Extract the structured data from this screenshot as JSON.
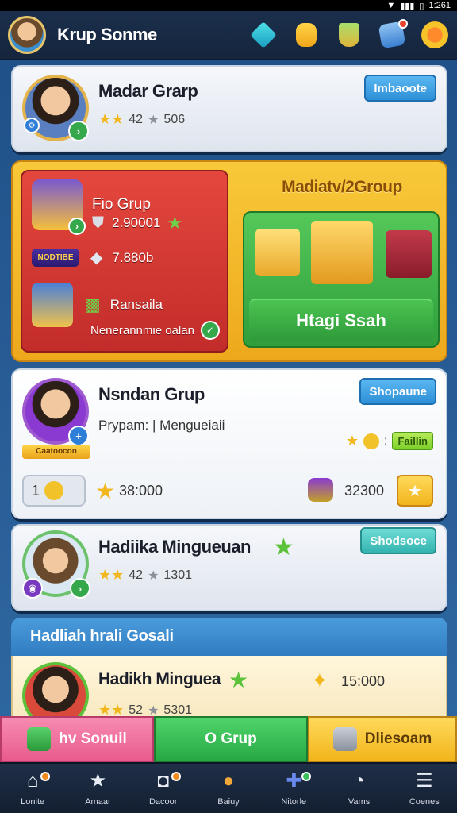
{
  "status": {
    "time": "1:261"
  },
  "header": {
    "title": "Krup Sonme"
  },
  "card1": {
    "title": "Madar Grarp",
    "score": "42",
    "count": "506",
    "button": "Imbaoote"
  },
  "promo": {
    "left_title": "Fio Grup",
    "row1_value": "2.90001",
    "row2_label": "NODTIBE",
    "row2_value": "7.880b",
    "row3_value": "Ransaila",
    "row4_value": "Nenerannmie oalan",
    "right_title": "Madiatv/2Group",
    "right_button": "Htagi Ssah"
  },
  "card2": {
    "title": "Nsndan Grup",
    "subtitle": "Prypam: | Mengueiaii",
    "badge": "Caatoocon",
    "tag": "Faillin",
    "tag_colon": ":",
    "coin_count": "1",
    "value_left": "38:000",
    "value_right": "32300",
    "button": "Shopaune"
  },
  "card3": {
    "title": "Hadiika Mingueuan",
    "score": "42",
    "count": "1301",
    "button": "Shodsoce"
  },
  "section": {
    "header": "Hadliah hrali Gosali",
    "item_title": "Hadikh Minguea",
    "item_value": "15:000",
    "item_score": "52",
    "item_count": "5301"
  },
  "actions": {
    "pink": "hv Sonuil",
    "green": "O Grup",
    "yellow": "Dliesoam"
  },
  "nav": {
    "items": [
      {
        "label": "Lonite",
        "icon": "home-icon"
      },
      {
        "label": "Amaar",
        "icon": "star-icon"
      },
      {
        "label": "Dacoor",
        "icon": "camera-icon"
      },
      {
        "label": "Baiuy",
        "icon": "trophy-icon"
      },
      {
        "label": "Nitorle",
        "icon": "puzzle-icon"
      },
      {
        "label": "Vams",
        "icon": "gauge-icon"
      },
      {
        "label": "Coenes",
        "icon": "menu-icon"
      }
    ]
  }
}
